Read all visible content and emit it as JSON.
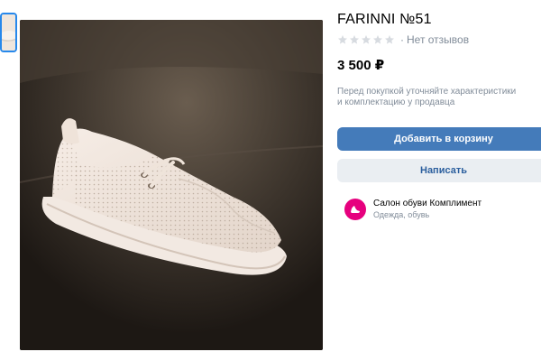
{
  "product": {
    "title": "FARINNI №51",
    "reviews_label": "Нет отзывов",
    "rating_stars": 0,
    "price": "3 500 ₽",
    "note": "Перед покупкой уточняйте характеристики и комплектацию у продавца"
  },
  "actions": {
    "add_to_cart": "Добавить в корзину",
    "message": "Написать"
  },
  "seller": {
    "name": "Салон обуви Комплимент",
    "category": "Одежда, обувь"
  },
  "icons": {
    "star": "star-icon",
    "avatar": "shop-logo"
  },
  "colors": {
    "primary": "#447bba",
    "secondary_bg": "#eaeef2",
    "secondary_text": "#2c5f9e",
    "muted": "#818c99",
    "avatar": "#e6007e",
    "thumb_border": "#2688eb"
  }
}
